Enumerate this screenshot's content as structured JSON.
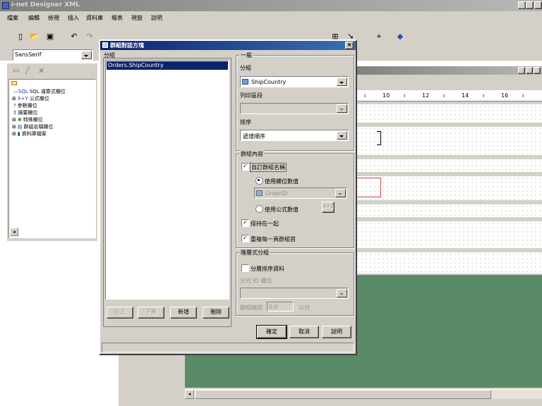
{
  "app": {
    "title": "i-net Designer XML",
    "menu": [
      "檔案",
      "編輯",
      "檢視",
      "插入",
      "資料庫",
      "報表",
      "視窗",
      "說明"
    ]
  },
  "toolbar": {
    "font_name": "SansSerif"
  },
  "explorer": {
    "items": [
      {
        "prefix": "—SQL",
        "label": "SQL 運算式欄位"
      },
      {
        "prefix": "X+Y",
        "label": "公式欄位"
      },
      {
        "prefix": "?",
        "label": "參數欄位"
      },
      {
        "prefix": "Σ",
        "label": "摘要欄位"
      },
      {
        "prefix": "✱",
        "label": "特殊欄位"
      },
      {
        "prefix": "▤",
        "label": "群組名稱欄位"
      },
      {
        "prefix": "▮",
        "label": "資料庫檔案"
      }
    ]
  },
  "ruler": {
    "labels": [
      "10",
      "12",
      "14",
      "16"
    ]
  },
  "dialog": {
    "title": "群組對話方塊",
    "list_section_label": "分組",
    "group_list": [
      "Orders.ShipCountry"
    ],
    "list_buttons": {
      "up": "往上",
      "down": "下移",
      "add": "新增",
      "delete": "刪除"
    },
    "general": {
      "section_label": "一般",
      "group_label": "分組",
      "group_value": "ShipCountry",
      "sort_field_label": "列印區段",
      "sort_field_value": "",
      "sort_label": "排序",
      "sort_value": "遞增順序"
    },
    "group_content": {
      "section_label": "群組內容",
      "custom_name_label": "自訂群組名稱",
      "custom_name_checked": true,
      "use_field_label": "使用欄位數值",
      "field_value": "OrderID",
      "use_formula_label": "使用公式數值",
      "formula_button": "X+2",
      "keep_together_label": "保持在一起",
      "keep_together_checked": true,
      "repeat_header_label": "重複每一頁群組首",
      "repeat_header_checked": true
    },
    "hierarchical": {
      "section_label": "階層式分組",
      "sort_data_label": "分層排序資料",
      "sort_data_checked": false,
      "parent_id_label": "父代 ID 欄位",
      "indent_label": "群組縮排",
      "indent_value": "0.0",
      "indent_unit": "公分"
    },
    "buttons": {
      "ok": "確定",
      "cancel": "取消",
      "help": "說明"
    }
  },
  "colors": {
    "desktop_green": "#5a8a66",
    "title_active": "#0a246a",
    "face": "#d4d0c8"
  }
}
